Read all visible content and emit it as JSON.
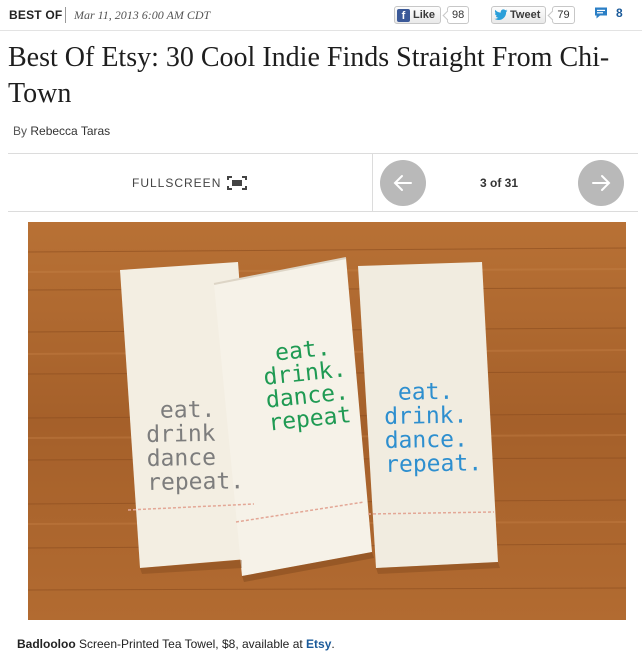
{
  "header": {
    "section": "BEST OF",
    "dateline": "Mar 11, 2013 6:00 AM CDT",
    "like_label": "Like",
    "like_count": "98",
    "tweet_label": "Tweet",
    "tweet_count": "79",
    "comment_count": "8"
  },
  "article": {
    "title": "Best Of Etsy: 30 Cool Indie Finds Straight From Chi-Town",
    "byline_prefix": "By",
    "author": "Rebecca Taras"
  },
  "slideshow": {
    "fullscreen_label": "FULLSCREEN",
    "counter": "3 of 31",
    "towels": [
      {
        "lines": [
          "eat.",
          "drink",
          "dance",
          "repeat."
        ],
        "color": "#7d7d7d"
      },
      {
        "lines": [
          "eat.",
          "drink.",
          "dance.",
          "repeat"
        ],
        "color": "#1f9a53"
      },
      {
        "lines": [
          "eat.",
          "drink.",
          "dance.",
          "repeat."
        ],
        "color": "#2e8fcf"
      }
    ]
  },
  "caption": {
    "vendor": "Badlooloo",
    "text": " Screen-Printed Tea Towel, $8, available at ",
    "link": "Etsy",
    "end": "."
  },
  "colors": {
    "link": "#1a5a9a",
    "facebook": "#3b5998",
    "twitter": "#2b9fd9",
    "arrow_button": "#b9b9b9",
    "wood": "#a7632f"
  }
}
